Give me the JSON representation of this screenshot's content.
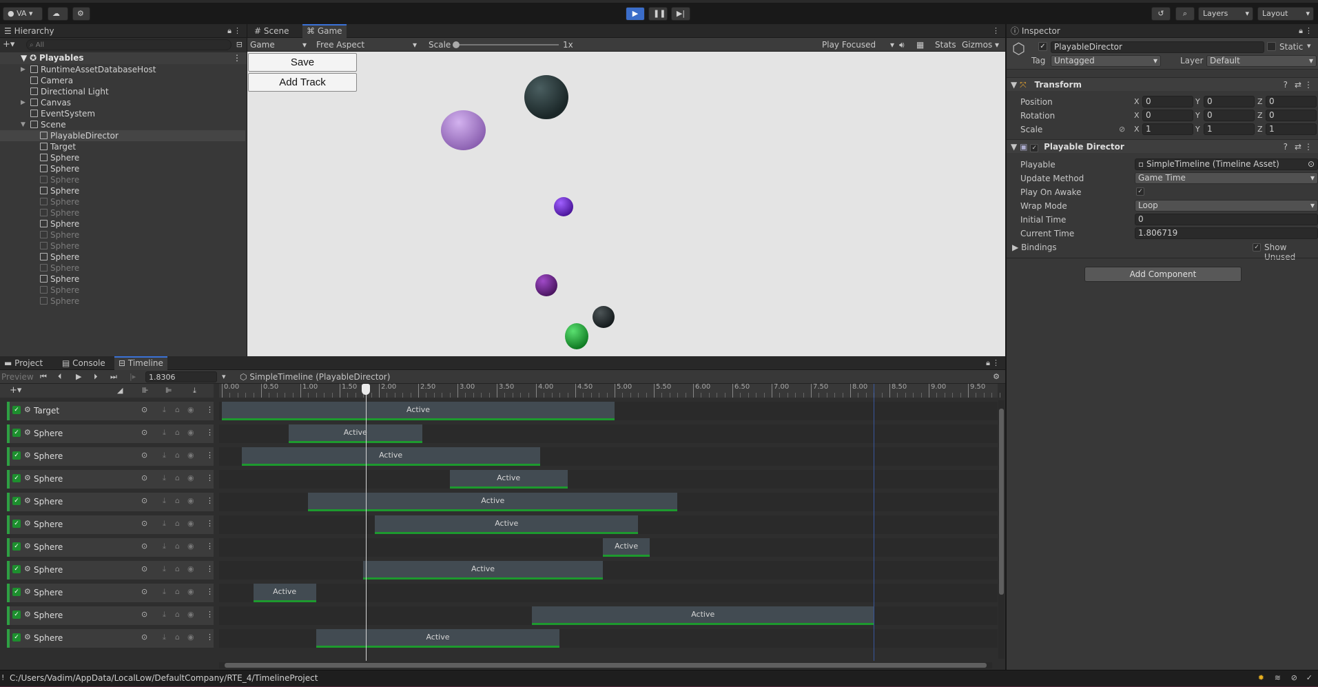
{
  "toolbar": {
    "account": "VA",
    "layers": "Layers",
    "layout": "Layout"
  },
  "hierarchy": {
    "tab": "Hierarchy",
    "search_placeholder": "All",
    "root": "Playables",
    "items": [
      {
        "label": "RuntimeAssetDatabaseHost",
        "indent": 1,
        "arrow": true,
        "dim": false,
        "selected": false
      },
      {
        "label": "Camera",
        "indent": 1,
        "arrow": false,
        "dim": false,
        "selected": false
      },
      {
        "label": "Directional Light",
        "indent": 1,
        "arrow": false,
        "dim": false,
        "selected": false
      },
      {
        "label": "Canvas",
        "indent": 1,
        "arrow": true,
        "dim": false,
        "selected": false
      },
      {
        "label": "EventSystem",
        "indent": 1,
        "arrow": false,
        "dim": false,
        "selected": false
      },
      {
        "label": "Scene",
        "indent": 1,
        "arrow": true,
        "dim": false,
        "selected": false
      },
      {
        "label": "PlayableDirector",
        "indent": 2,
        "arrow": false,
        "dim": false,
        "selected": true
      },
      {
        "label": "Target",
        "indent": 2,
        "arrow": false,
        "dim": false,
        "selected": false
      },
      {
        "label": "Sphere",
        "indent": 2,
        "arrow": false,
        "dim": false,
        "selected": false
      },
      {
        "label": "Sphere",
        "indent": 2,
        "arrow": false,
        "dim": false,
        "selected": false
      },
      {
        "label": "Sphere",
        "indent": 2,
        "arrow": false,
        "dim": true,
        "selected": false
      },
      {
        "label": "Sphere",
        "indent": 2,
        "arrow": false,
        "dim": false,
        "selected": false
      },
      {
        "label": "Sphere",
        "indent": 2,
        "arrow": false,
        "dim": true,
        "selected": false
      },
      {
        "label": "Sphere",
        "indent": 2,
        "arrow": false,
        "dim": true,
        "selected": false
      },
      {
        "label": "Sphere",
        "indent": 2,
        "arrow": false,
        "dim": false,
        "selected": false
      },
      {
        "label": "Sphere",
        "indent": 2,
        "arrow": false,
        "dim": true,
        "selected": false
      },
      {
        "label": "Sphere",
        "indent": 2,
        "arrow": false,
        "dim": true,
        "selected": false
      },
      {
        "label": "Sphere",
        "indent": 2,
        "arrow": false,
        "dim": false,
        "selected": false
      },
      {
        "label": "Sphere",
        "indent": 2,
        "arrow": false,
        "dim": true,
        "selected": false
      },
      {
        "label": "Sphere",
        "indent": 2,
        "arrow": false,
        "dim": false,
        "selected": false
      },
      {
        "label": "Sphere",
        "indent": 2,
        "arrow": false,
        "dim": true,
        "selected": false
      },
      {
        "label": "Sphere",
        "indent": 2,
        "arrow": false,
        "dim": true,
        "selected": false
      }
    ]
  },
  "game_view": {
    "tabs": [
      "Scene",
      "Game"
    ],
    "display": "Game",
    "aspect": "Free Aspect",
    "scale_label": "Scale",
    "scale_value": "1x",
    "play_mode": "Play Focused",
    "stats": "Stats",
    "gizmos": "Gizmos",
    "save_button": "Save",
    "add_track_button": "Add Track"
  },
  "inspector": {
    "tab": "Inspector",
    "object_name": "PlayableDirector",
    "static_label": "Static",
    "tag_label": "Tag",
    "tag_value": "Untagged",
    "layer_label": "Layer",
    "layer_value": "Default",
    "transform": {
      "title": "Transform",
      "position_label": "Position",
      "rotation_label": "Rotation",
      "scale_label": "Scale",
      "position": [
        "0",
        "0",
        "0"
      ],
      "rotation": [
        "0",
        "0",
        "0"
      ],
      "scale": [
        "1",
        "1",
        "1"
      ]
    },
    "director": {
      "title": "Playable Director",
      "playable_label": "Playable",
      "playable_value": "SimpleTimeline (Timeline Asset)",
      "update_method_label": "Update Method",
      "update_method_value": "Game Time",
      "play_on_awake_label": "Play On Awake",
      "wrap_mode_label": "Wrap Mode",
      "wrap_mode_value": "Loop",
      "initial_time_label": "Initial Time",
      "initial_time_value": "0",
      "current_time_label": "Current Time",
      "current_time_value": "1.806719",
      "bindings_label": "Bindings",
      "show_unused_label": "Show Unused"
    },
    "add_component": "Add Component"
  },
  "bottom_tabs": [
    "Project",
    "Console",
    "Timeline"
  ],
  "timeline": {
    "preview_label": "Preview",
    "time_value": "1.8306",
    "asset_label": "SimpleTimeline (PlayableDirector)",
    "ruler_ticks": [
      "0.00",
      "0.50",
      "1.00",
      "1.50",
      "2.00",
      "2.50",
      "3.00",
      "3.50",
      "4.00",
      "4.50",
      "5.00",
      "5.50",
      "6.00",
      "6.50",
      "7.00",
      "7.50",
      "8.00",
      "8.50",
      "9.00",
      "9.50"
    ],
    "playhead_time": 1.8306,
    "end_marker_time": 8.3,
    "tracks": [
      {
        "name": "Target",
        "clip_label": "Active",
        "start": 0.0,
        "end": 5.0
      },
      {
        "name": "Sphere",
        "clip_label": "Active",
        "start": 0.85,
        "end": 2.55
      },
      {
        "name": "Sphere",
        "clip_label": "Active",
        "start": 0.25,
        "end": 4.05
      },
      {
        "name": "Sphere",
        "clip_label": "Active",
        "start": 2.9,
        "end": 4.4
      },
      {
        "name": "Sphere",
        "clip_label": "Active",
        "start": 1.1,
        "end": 5.8
      },
      {
        "name": "Sphere",
        "clip_label": "Active",
        "start": 1.95,
        "end": 5.3
      },
      {
        "name": "Sphere",
        "clip_label": "Active",
        "start": 4.85,
        "end": 5.45
      },
      {
        "name": "Sphere",
        "clip_label": "Active",
        "start": 1.8,
        "end": 4.85
      },
      {
        "name": "Sphere",
        "clip_label": "Active",
        "start": 0.4,
        "end": 1.2
      },
      {
        "name": "Sphere",
        "clip_label": "Active",
        "start": 3.95,
        "end": 8.3
      },
      {
        "name": "Sphere",
        "clip_label": "Active",
        "start": 1.2,
        "end": 4.3
      }
    ]
  },
  "status_bar": {
    "path": "C:/Users/Vadim/AppData/LocalLow/DefaultCompany/RTE_4/TimelineProject"
  },
  "colors": {
    "accent": "#3a72d8",
    "track_green": "#2ea043"
  }
}
